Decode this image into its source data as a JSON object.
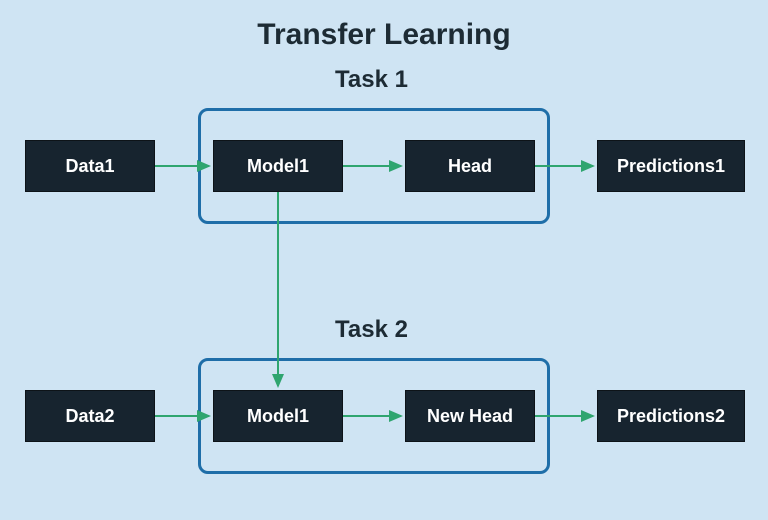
{
  "title": "Transfer Learning",
  "task1": {
    "label": "Task 1",
    "data": "Data1",
    "model": "Model1",
    "head": "Head",
    "predictions": "Predictions1"
  },
  "task2": {
    "label": "Task 2",
    "data": "Data2",
    "model": "Model1",
    "head": "New Head",
    "predictions": "Predictions2"
  },
  "colors": {
    "background": "#cfe4f3",
    "node_bg": "#17242f",
    "node_text": "#ffffff",
    "group_border": "#1f6ea8",
    "arrow": "#2fa56f"
  }
}
